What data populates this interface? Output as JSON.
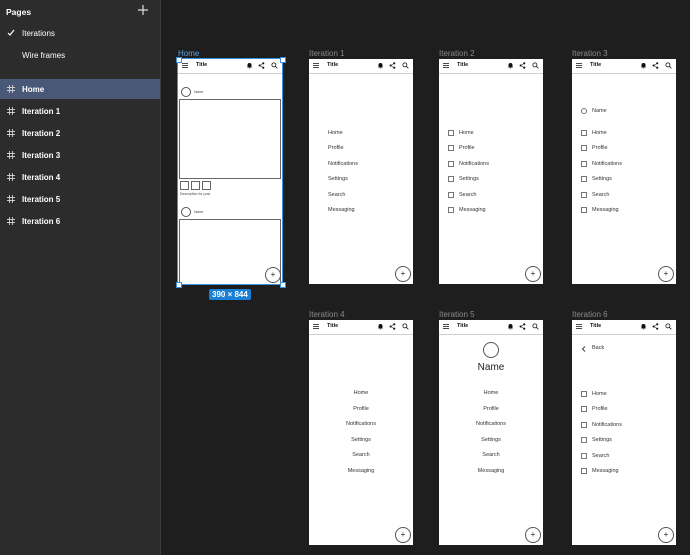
{
  "sidebar": {
    "header": "Pages",
    "pages": [
      {
        "label": "Iterations",
        "checked": true
      },
      {
        "label": "Wire frames",
        "checked": false
      }
    ],
    "layers": [
      {
        "label": "Home",
        "selected": true
      },
      {
        "label": "Iteration 1"
      },
      {
        "label": "Iteration 2"
      },
      {
        "label": "Iteration 3"
      },
      {
        "label": "Iteration 4"
      },
      {
        "label": "Iteration 5"
      },
      {
        "label": "Iteration 6"
      }
    ]
  },
  "frames": {
    "home": {
      "label": "Home",
      "size": "390 × 844",
      "name_text": "Name",
      "caption": "Description for post"
    },
    "it1": {
      "label": "Iteration 1"
    },
    "it2": {
      "label": "Iteration 2"
    },
    "it3": {
      "label": "Iteration 3",
      "name_text": "Name"
    },
    "it4": {
      "label": "Iteration 4"
    },
    "it5": {
      "label": "Iteration 5",
      "name_text": "Name"
    },
    "it6": {
      "label": "Iteration 6",
      "back_text": "Back"
    }
  },
  "appbar": {
    "title": "Title"
  },
  "nav_items": [
    "Home",
    "Profile",
    "Notifications",
    "Settings",
    "Search",
    "Messaging"
  ],
  "fab_label": "+",
  "colors": {
    "canvas": "#1e1e1e",
    "sidebar": "#2c2c2c",
    "selection": "#3a8fe0",
    "selected_row": "#4a5878"
  }
}
